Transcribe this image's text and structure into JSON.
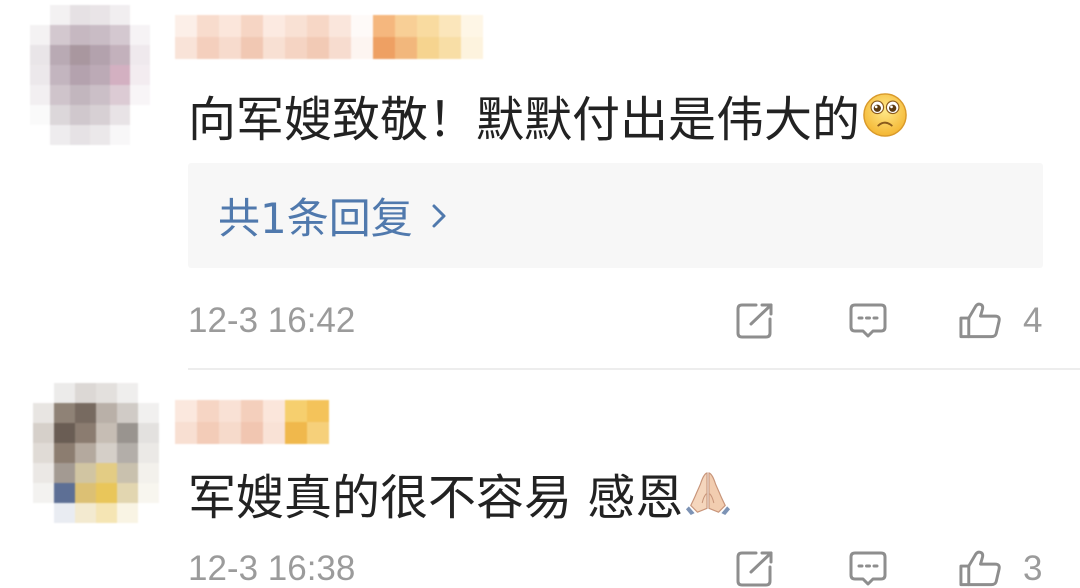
{
  "colors": {
    "text": "#222222",
    "meta": "#9b9b9b",
    "link": "#5079ad",
    "reply_bg": "#f7f7f7",
    "icon": "#8e8e8e",
    "divider": "#ededed"
  },
  "action_icons": {
    "share": "share-icon",
    "comment": "comment-icon",
    "like": "like-icon",
    "replies": "chevron-right-icon"
  },
  "comments": [
    {
      "avatar_mosaic": [
        [
          "#ffffff",
          "#f3f1f2",
          "#e6e1e4",
          "#e9e4e7",
          "#f1eef0",
          "#ffffff"
        ],
        [
          "#f4f2f3",
          "#d3c8cf",
          "#c6b8c1",
          "#c9bcc5",
          "#d4c8d0",
          "#f6f3f5"
        ],
        [
          "#e9e5e8",
          "#b9aab4",
          "#a9979f",
          "#b3a2ad",
          "#c3b1bc",
          "#efe9ed"
        ],
        [
          "#ece8eb",
          "#c3b5bf",
          "#b4a2ae",
          "#bcaab6",
          "#d3b0c1",
          "#f3ecf0"
        ],
        [
          "#f2eff1",
          "#cfc4cb",
          "#c2b6be",
          "#cbbfc7",
          "#dccbd4",
          "#f8f5f7"
        ],
        [
          "#fafafa",
          "#dcd7da",
          "#d0c8cd",
          "#d7d0d4",
          "#e8e3e6",
          "#ffffff"
        ],
        [
          "#ffffff",
          "#eeecee",
          "#e6e2e5",
          "#ebe8ea",
          "#f8f7f8",
          "#ffffff"
        ]
      ],
      "username_mosaic": [
        [
          "#fcefe8",
          "#f8dccd",
          "#fbe6db",
          "#f6d5c4",
          "#fceae1",
          "#f9e1d4",
          "#f7d7c6",
          "#fae6dc",
          "#fefaf8",
          "#f5b77e",
          "#f8cf96",
          "#f9dba0",
          "#fbe6bb",
          "#fef6e6"
        ],
        [
          "#f9e3d8",
          "#f4cfbd",
          "#f7dbcd",
          "#f1c8b3",
          "#f8e0d3",
          "#f5d4c3",
          "#f2cab5",
          "#f7dccf",
          "#fdf5f1",
          "#eea063",
          "#f2b77c",
          "#f6d48f",
          "#f8dea6",
          "#fdf3de"
        ]
      ],
      "text": "向军嫂致敬！默默付出是伟大的",
      "emoji_icon": "pleading-face-emoji",
      "replies_label": "共1条回复",
      "timestamp": "12-3 16:42",
      "like_count": "4"
    },
    {
      "avatar_mosaic": [
        [
          "#ffffff",
          "#ecebea",
          "#dcd8d5",
          "#e3e0dd",
          "#efeeed",
          "#ffffff"
        ],
        [
          "#e8e5e2",
          "#8f8276",
          "#776a60",
          "#b9b0a8",
          "#d0cbc6",
          "#f1f0ef"
        ],
        [
          "#d6d0ca",
          "#6a5d54",
          "#8b7c70",
          "#c6bdb4",
          "#99948f",
          "#e3e1df"
        ],
        [
          "#e0dbd6",
          "#8c7d70",
          "#b4a99e",
          "#d5cfc8",
          "#b3aea9",
          "#ebe9e6"
        ],
        [
          "#ebe8e5",
          "#a39a92",
          "#d1c5a2",
          "#e3cc84",
          "#c9c1ae",
          "#f3f1ec"
        ],
        [
          "#f3f2f0",
          "#5d6f95",
          "#dcc074",
          "#e9c65a",
          "#e2d6b0",
          "#f8f6ef"
        ],
        [
          "#ffffff",
          "#e9ecf2",
          "#f3ead0",
          "#f5e5b4",
          "#f9f4e4",
          "#ffffff"
        ]
      ],
      "username_mosaic": [
        [
          "#fbe8de",
          "#f6d5c4",
          "#f9e1d5",
          "#f4cfbc",
          "#fbe6db",
          "#f6cf6e",
          "#f4c35a"
        ],
        [
          "#f8dfd2",
          "#f3ccb8",
          "#f6dacb",
          "#f1c6b1",
          "#f9e2d6",
          "#f0b84c",
          "#f6d07a"
        ]
      ],
      "text": "军嫂真的很不容易 感恩",
      "emoji_icon": "folded-hands-emoji",
      "timestamp": "12-3 16:38",
      "like_count": "3"
    }
  ]
}
